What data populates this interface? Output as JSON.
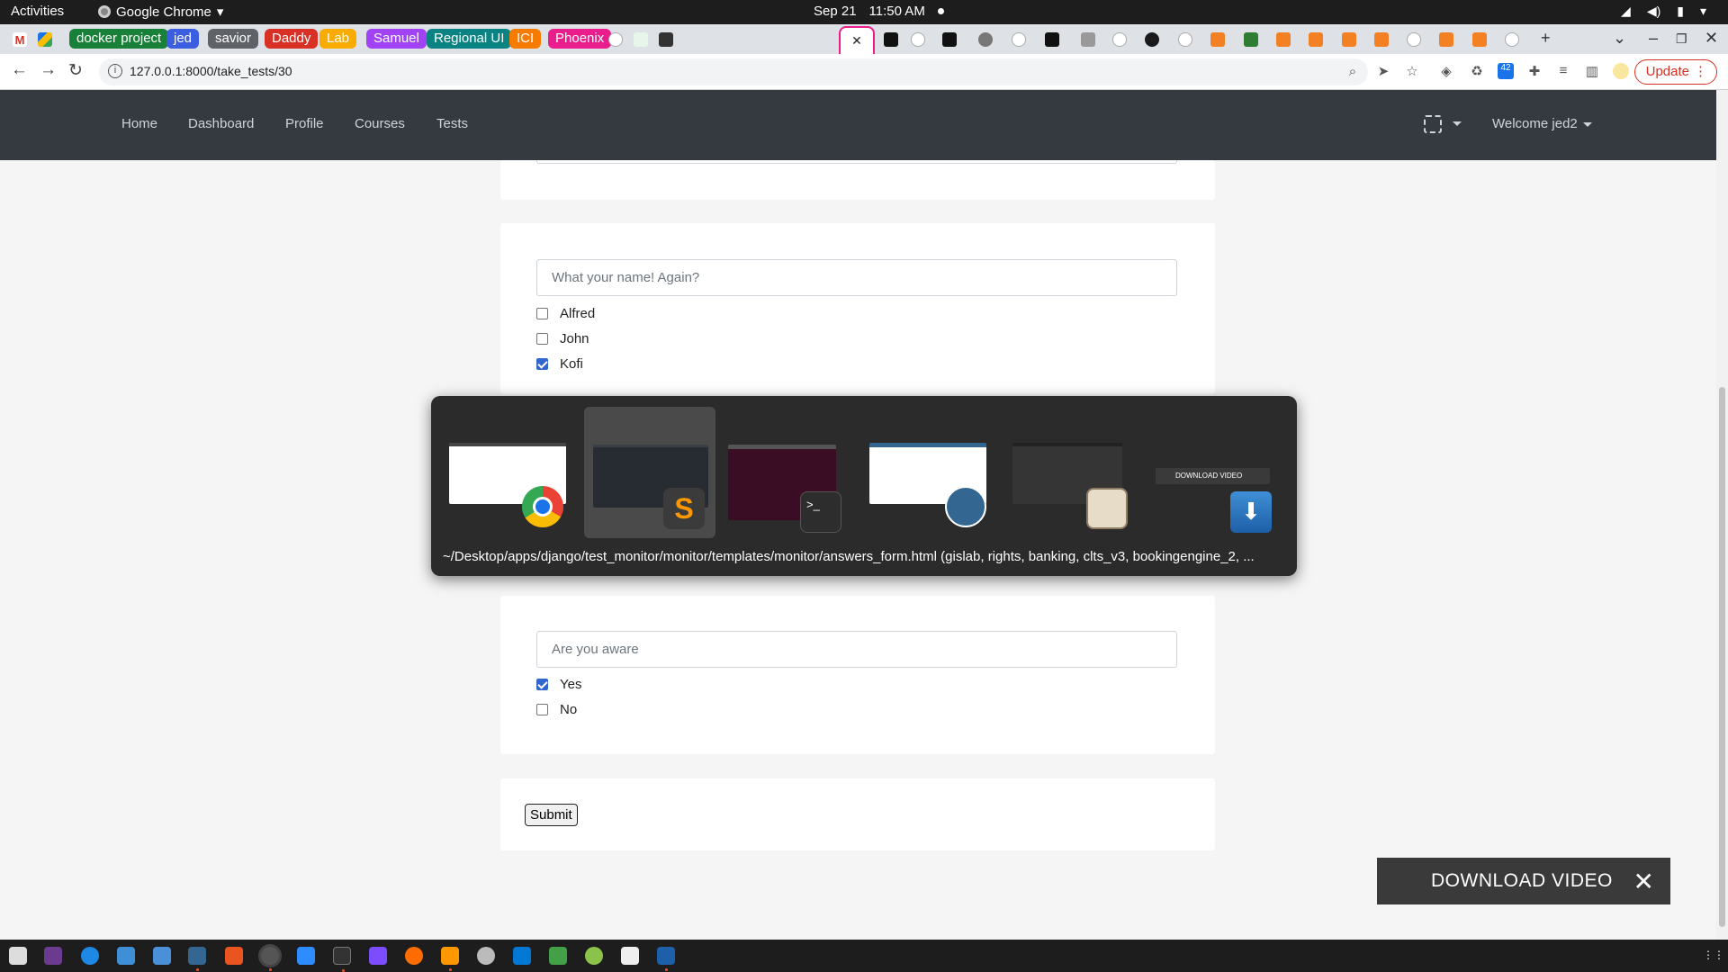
{
  "topbar": {
    "activities": "Activities",
    "app_name": "Google Chrome",
    "date": "Sep 21",
    "time": "11:50 AM"
  },
  "tabs": {
    "groups": [
      {
        "label": "docker project",
        "color": "#188038"
      },
      {
        "label": "jed",
        "color": "#3b5ee0"
      },
      {
        "label": "savior",
        "color": "#5f6368"
      },
      {
        "label": "Daddy",
        "color": "#d93025"
      },
      {
        "label": "Lab",
        "color": "#f9ab00"
      },
      {
        "label": "Samuel",
        "color": "#a142f4"
      },
      {
        "label": "Regional UI",
        "color": "#0b8383"
      },
      {
        "label": "ICI",
        "color": "#f57c00"
      },
      {
        "label": "Phoenix",
        "color": "#e91e8c"
      }
    ],
    "active_close": "✕",
    "new_tab": "+"
  },
  "address": {
    "url": "127.0.0.1:8000/take_tests/30",
    "extension_badge": "42",
    "update_label": "Update"
  },
  "navbar": {
    "links": [
      "Home",
      "Dashboard",
      "Profile",
      "Courses",
      "Tests"
    ],
    "welcome": "Welcome jed2"
  },
  "questions": [
    {
      "prompt": "What your name! Again?",
      "options": [
        {
          "label": "Alfred",
          "checked": false
        },
        {
          "label": "John",
          "checked": false
        },
        {
          "label": "Kofi",
          "checked": true
        }
      ]
    },
    {
      "prompt": "Are you aware",
      "options": [
        {
          "label": "Yes",
          "checked": true
        },
        {
          "label": "No",
          "checked": false
        }
      ]
    }
  ],
  "submit_label": "Submit",
  "switcher": {
    "caption": "~/Desktop/apps/django/test_monitor/monitor/templates/monitor/answers_form.html (gislab, rights, banking, clts_v3, bookingengine_2, ...",
    "mini_download_label": "DOWNLOAD VIDEO",
    "windows": [
      "Google Chrome",
      "Sublime Text",
      "Terminal",
      "pgAdmin",
      "Files",
      "Video Downloader"
    ]
  },
  "download_video": {
    "label": "DOWNLOAD VIDEO",
    "close": "✕"
  }
}
